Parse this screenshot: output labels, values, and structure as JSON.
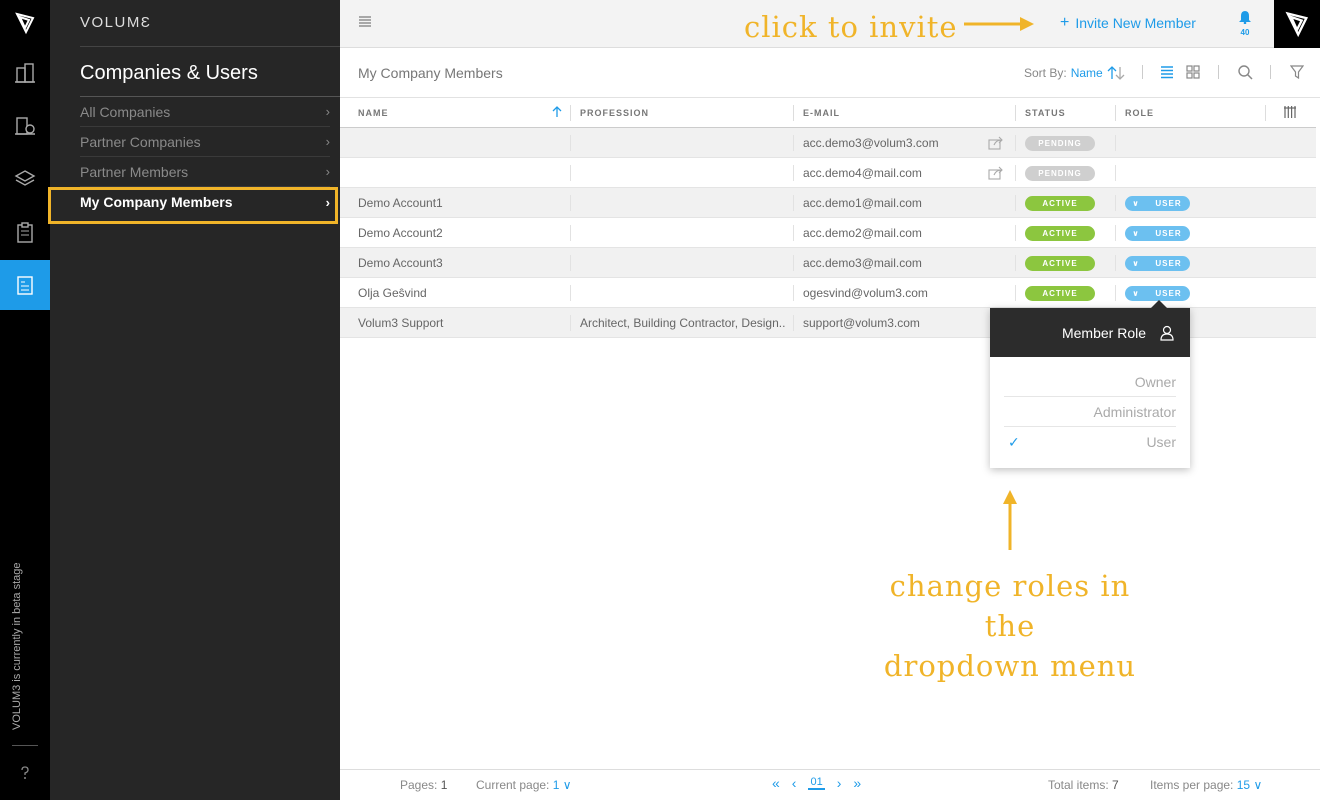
{
  "rail": {
    "beta_text": "VOLUM3 is currently in beta stage"
  },
  "side": {
    "brand": "VOLUMƐ",
    "section_title": "Companies & Users",
    "nav": [
      {
        "label": "All Companies"
      },
      {
        "label": "Partner Companies"
      },
      {
        "label": "Partner Members"
      },
      {
        "label": "My Company Members"
      }
    ]
  },
  "topbar": {
    "invite_hint": "click to invite",
    "invite_label": "Invite New Member",
    "notification_count": "40"
  },
  "content": {
    "page_title": "My Company Members",
    "sort_label": "Sort By:",
    "sort_value": "Name"
  },
  "table": {
    "columns": [
      "NAME",
      "PROFESSION",
      "E-MAIL",
      "STATUS",
      "ROLE"
    ],
    "rows": [
      {
        "name": "",
        "profession": "",
        "email": "acc.demo3@volum3.com",
        "status": "PENDING",
        "role": ""
      },
      {
        "name": "",
        "profession": "",
        "email": "acc.demo4@mail.com",
        "status": "PENDING",
        "role": ""
      },
      {
        "name": "Demo Account1",
        "profession": "",
        "email": "acc.demo1@mail.com",
        "status": "ACTIVE",
        "role": "USER"
      },
      {
        "name": "Demo Account2",
        "profession": "",
        "email": "acc.demo2@mail.com",
        "status": "ACTIVE",
        "role": "USER"
      },
      {
        "name": "Demo Account3",
        "profession": "",
        "email": "acc.demo3@mail.com",
        "status": "ACTIVE",
        "role": "USER"
      },
      {
        "name": "Olja Geŝvind",
        "profession": "",
        "email": "ogesvind@volum3.com",
        "status": "ACTIVE",
        "role": "USER"
      },
      {
        "name": "Volum3 Support",
        "profession": "Architect, Building Contractor, Design...",
        "email": "support@volum3.com",
        "status": "",
        "role": ""
      }
    ]
  },
  "dropdown": {
    "title": "Member Role",
    "options": [
      "Owner",
      "Administrator",
      "User"
    ],
    "selected": "User",
    "check": "✓"
  },
  "annotation": {
    "line1": "change roles in the",
    "line2": "dropdown menu"
  },
  "footer": {
    "pages_label": "Pages:",
    "pages_value": "1",
    "current_label": "Current page:",
    "current_value": "1",
    "page_number": "01",
    "total_label": "Total items:",
    "total_value": "7",
    "per_page_label": "Items per page:",
    "per_page_value": "15"
  },
  "colors": {
    "accent": "#1e9be8",
    "annotation": "#f0b429",
    "active": "#8cc63f",
    "pending": "#cfcfcf",
    "role": "#6cc0f0"
  }
}
